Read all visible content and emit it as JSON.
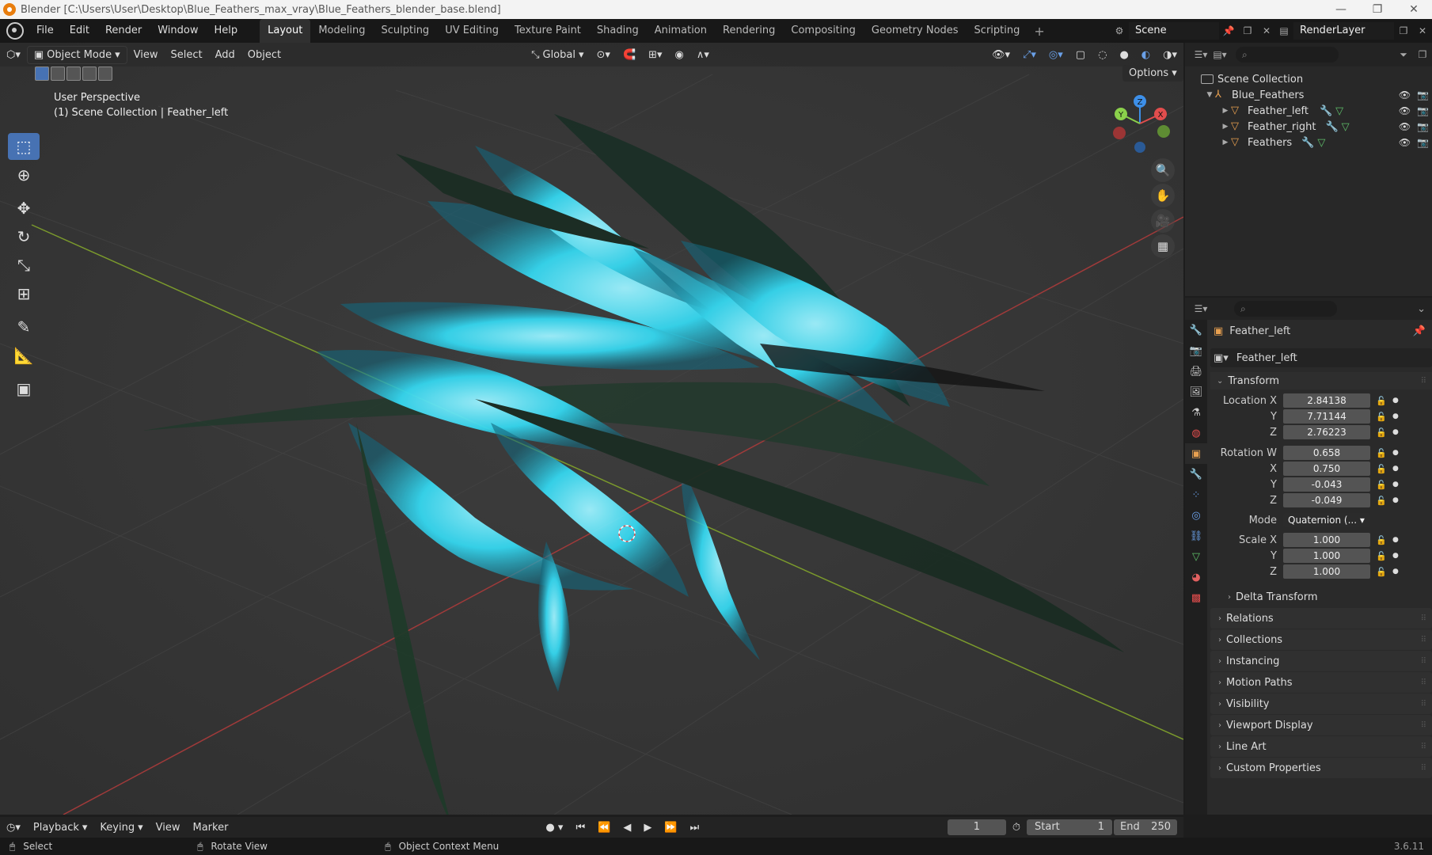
{
  "window": {
    "title": "Blender [C:\\Users\\User\\Desktop\\Blue_Feathers_max_vray\\Blue_Feathers_blender_base.blend]"
  },
  "menu": [
    "File",
    "Edit",
    "Render",
    "Window",
    "Help"
  ],
  "workspaces": [
    "Layout",
    "Modeling",
    "Sculpting",
    "UV Editing",
    "Texture Paint",
    "Shading",
    "Animation",
    "Rendering",
    "Compositing",
    "Geometry Nodes",
    "Scripting"
  ],
  "active_workspace": "Layout",
  "scene_name": "Scene",
  "render_layer": "RenderLayer",
  "viewport": {
    "mode": "Object Mode",
    "menus": [
      "View",
      "Select",
      "Add",
      "Object"
    ],
    "orientation": "Global",
    "options_label": "Options",
    "info_line1": "User Perspective",
    "info_line2": "(1) Scene Collection | Feather_left"
  },
  "gizmo": {
    "x": "X",
    "y": "Y",
    "z": "Z"
  },
  "outliner": {
    "root": "Scene Collection",
    "collection": "Blue_Feathers",
    "objects": [
      "Feather_left",
      "Feather_right",
      "Feathers"
    ]
  },
  "properties": {
    "object_name": "Feather_left",
    "datablock_name": "Feather_left",
    "transform_label": "Transform",
    "location": {
      "label": "Location X",
      "x": "2.84138",
      "y": "7.71144",
      "z": "2.76223"
    },
    "rotation": {
      "label": "Rotation W",
      "w": "0.658",
      "x": "0.750",
      "y": "-0.043",
      "z": "-0.049"
    },
    "mode_label": "Mode",
    "mode_value": "Quaternion (...",
    "scale": {
      "label": "Scale X",
      "x": "1.000",
      "y": "1.000",
      "z": "1.000"
    },
    "axis_y": "Y",
    "axis_z": "Z",
    "axis_x": "X",
    "delta": "Delta Transform",
    "subpanels": [
      "Relations",
      "Collections",
      "Instancing",
      "Motion Paths",
      "Visibility",
      "Viewport Display",
      "Line Art",
      "Custom Properties"
    ]
  },
  "timeline": {
    "menus": [
      "Playback",
      "Keying",
      "View",
      "Marker"
    ],
    "current_frame": "1",
    "start_label": "Start",
    "start": "1",
    "end_label": "End",
    "end": "250"
  },
  "status": {
    "left": "Select",
    "middle": "Rotate View",
    "right": "Object Context Menu",
    "version": "3.6.11"
  },
  "colors": {
    "accent": "#4772b3",
    "feather": "#35d7f0",
    "x_axis": "#e24d4d",
    "y_axis": "#8bd14b",
    "z_axis": "#3d8fe8"
  }
}
